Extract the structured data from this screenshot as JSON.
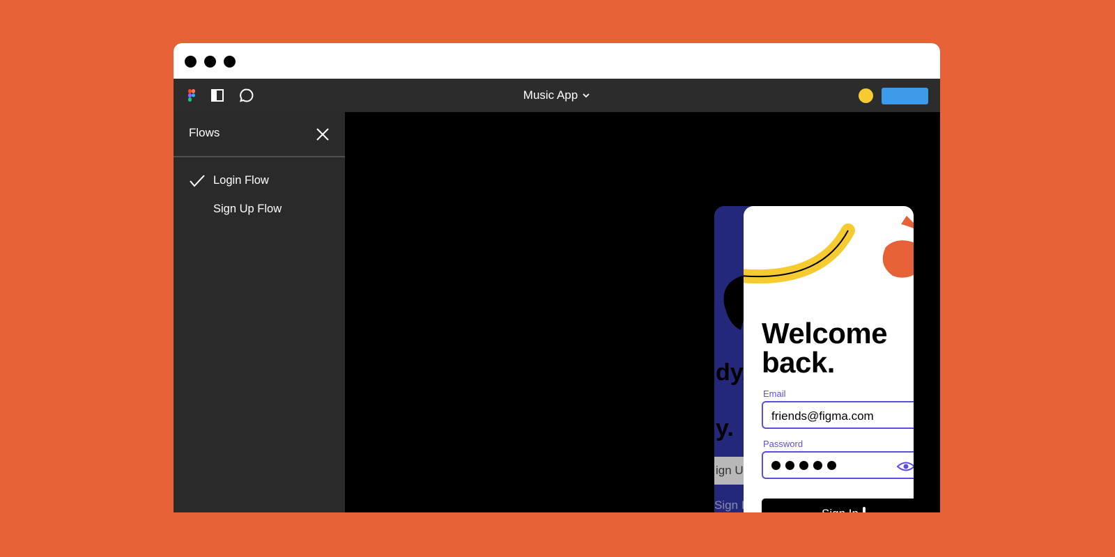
{
  "toolbar": {
    "file_name": "Music App",
    "icons": [
      "figma-logo-icon",
      "layout-panel-icon",
      "comment-icon",
      "chevron-down-icon"
    ],
    "avatar_color": "#F6CB2F",
    "share_color": "#3D9BEA"
  },
  "panel": {
    "title": "Flows",
    "flows": [
      {
        "label": "Login Flow",
        "active": true
      },
      {
        "label": "Sign Up Flow",
        "active": false
      }
    ]
  },
  "prototype": {
    "behind_fragments": [
      "dy,",
      "y.",
      "ign U",
      "Sign I"
    ],
    "heading_line1": "Welcome",
    "heading_line2": "back.",
    "email_label": "Email",
    "email_value": "friends@figma.com",
    "password_label": "Password",
    "password_length": 5,
    "signin_label": "Sign In",
    "accent_color": "#5B4EDF"
  },
  "colors": {
    "background": "#E66136",
    "toolbar": "#2C2C2C",
    "panel": "#2A2A2A"
  }
}
